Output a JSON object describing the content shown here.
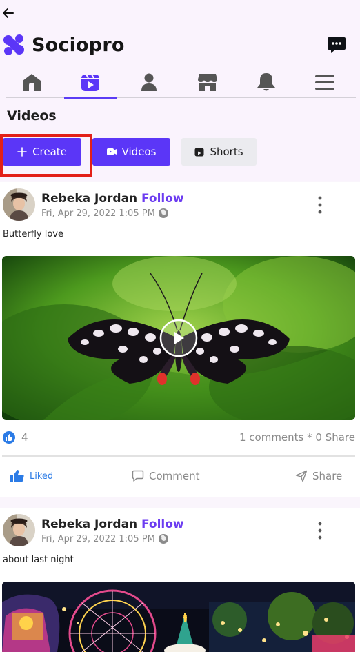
{
  "app": {
    "title": "Sociopro"
  },
  "header": {
    "back_icon": "arrow-left-icon",
    "messages_icon": "message-bubble-icon"
  },
  "tabs": [
    {
      "name": "home",
      "icon": "home-icon",
      "active": false
    },
    {
      "name": "videos",
      "icon": "video-reel-icon",
      "active": true
    },
    {
      "name": "profile",
      "icon": "person-icon",
      "active": false
    },
    {
      "name": "store",
      "icon": "storefront-icon",
      "active": false
    },
    {
      "name": "notifications",
      "icon": "bell-icon",
      "active": false
    },
    {
      "name": "menu",
      "icon": "hamburger-menu-icon",
      "active": false
    }
  ],
  "section": {
    "title": "Videos"
  },
  "buttons": {
    "create": "Create",
    "videos": "Videos",
    "shorts": "Shorts"
  },
  "posts": [
    {
      "author": "Rebeka Jordan",
      "follow": "Follow",
      "date": "Fri, Apr 29, 2022 1:05 PM",
      "caption": "Butterfly love",
      "like_count": "4",
      "stats": "1 comments * 0 Share",
      "actions": {
        "like": "Liked",
        "comment": "Comment",
        "share": "Share"
      }
    },
    {
      "author": "Rebeka Jordan",
      "follow": "Follow",
      "date": "Fri, Apr 29, 2022 1:05 PM",
      "caption": "about last night"
    }
  ],
  "colors": {
    "accent": "#5b36f7",
    "follow": "#6c3cf1",
    "liked": "#2b7be6",
    "highlight": "#e32018"
  }
}
